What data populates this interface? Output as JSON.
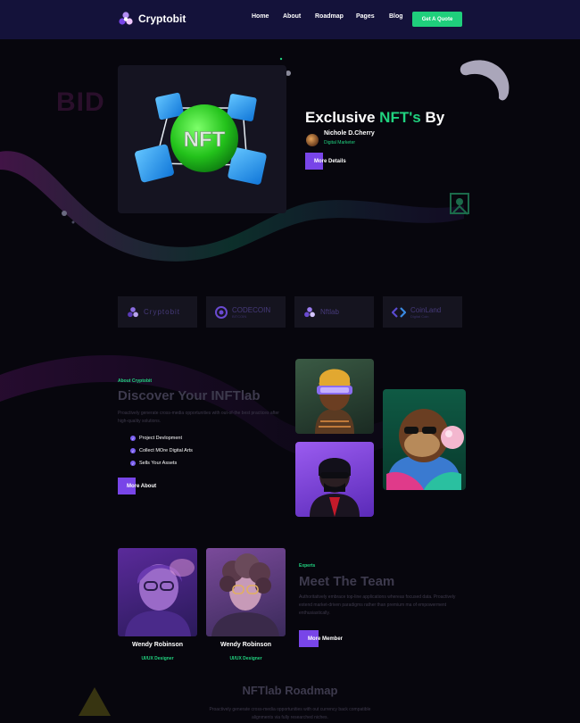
{
  "header": {
    "logo_text": "Cryptobit",
    "nav": [
      "Home",
      "About",
      "Roadmap",
      "Pages",
      "Blog"
    ],
    "cta_label": "Get A Quote"
  },
  "hero": {
    "watermark": "BID",
    "card_label": "NFT",
    "title_prefix": "Exclusive ",
    "title_highlight": "NFT's",
    "title_suffix": " By",
    "author_name": "Nichole D.Cherry",
    "author_role": "Digital Marketer",
    "button_label": "More Details"
  },
  "brands": [
    {
      "name": "Cryptobit",
      "sub": ""
    },
    {
      "name": "CODECOIN",
      "sub": "BITCOIN"
    },
    {
      "name": "Nftlab",
      "sub": ""
    },
    {
      "name": "CoinLand",
      "sub": "Digital Coin"
    }
  ],
  "about": {
    "eyebrow": "About Cryptobit",
    "title": "Discover Your INFTlab",
    "text": "Proactively generate cross-media opportunities with out-of-the best practices after high-quality solutions.",
    "items": [
      "Project Devlopment",
      "Collect MOre Digital Arts",
      "Sells Your Assets"
    ],
    "button_label": "More About"
  },
  "team": {
    "eyebrow": "Experts",
    "title": "Meet The Team",
    "text": "Authoritatively embrace top-line applications whereas focused data. Proactively extend market-driven paradigms rather than premium ma of empowerment enthusiastically.",
    "button_label": "More Member",
    "members": [
      {
        "name": "Wendy Robinson",
        "role": "UI/UX Designer"
      },
      {
        "name": "Wendy Robinson",
        "role": "UI/UX Designer"
      }
    ]
  },
  "roadmap": {
    "title": "NFTlab Roadmap",
    "text": "Proactively generate cross-media opportunities with out currency back compatible alignments via fully researched niches."
  },
  "colors": {
    "accent_green": "#20d27f",
    "accent_purple": "#7845e8",
    "header_bg": "#14123a",
    "page_bg": "#07060d"
  }
}
